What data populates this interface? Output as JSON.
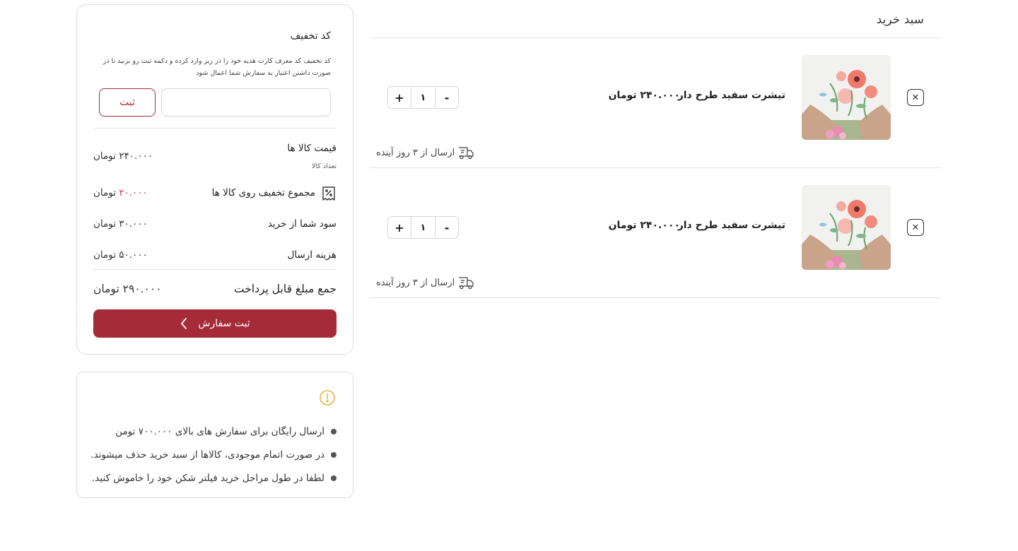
{
  "cart": {
    "title": "سبد خرید",
    "items": [
      {
        "name": "تیشرت سفید طرح دار",
        "price": "۲۴۰.۰۰۰ تومان",
        "quantity": "۱",
        "increase_label": "+",
        "decrease_label": "-",
        "remove_icon": "close-icon",
        "delivery": "ارسال از ۳ روز آینده",
        "delivery_icon": "delivery-truck-icon"
      },
      {
        "name": "تیشرت سفید طرح دار",
        "price": "۲۴۰.۰۰۰ تومان",
        "quantity": "۱",
        "increase_label": "+",
        "decrease_label": "-",
        "remove_icon": "close-icon",
        "delivery": "ارسال از ۳ روز آینده",
        "delivery_icon": "delivery-truck-icon"
      }
    ]
  },
  "summary": {
    "discount": {
      "title": "کد تخفیف",
      "description": "کد تخفیف کد معرف کارت هدیه خود را در زیر وارد کرده و دکمه ثبت رو بزنید تا در صورت داشتن اعتبار به سفارش شما اعمال شود",
      "input_value": "",
      "submit_label": "ثبت"
    },
    "items_price": {
      "label": "قیمت کالا ها",
      "sublabel": "تعداد کالا",
      "value": "۲۴۰.۰۰۰ تومان"
    },
    "items_discount": {
      "label": "مجموع تخفیف روی کالا ها",
      "value_amount": "۲۰.۰۰۰",
      "value_unit": "تومان",
      "icon": "discount-tag-icon"
    },
    "your_profit": {
      "label": "سود شما از خرید",
      "value": "۳۰.۰۰۰ تومان"
    },
    "shipping": {
      "label": "هزینه ارسال",
      "value": "۵۰.۰۰۰ تومان"
    },
    "total": {
      "label": "جمع مبلغ قابل پرداخت",
      "value": "۲۹۰.۰۰۰ تومان"
    },
    "checkout_label": "ثبت سفارش"
  },
  "notes": {
    "icon": "info-icon",
    "items": [
      "ارسال رایگان برای سفارش های بالای ۷۰۰.۰۰۰ تومن",
      "در صورت اتمام موجودی، کالاها از سبد خرید حذف میشوند.",
      "لطفا در طول مراحل خرید فیلتر شکن خود را خاموش کنید."
    ]
  },
  "colors": {
    "accent": "#a62b39",
    "discount_value": "#c0394b",
    "info_icon": "#e6b53c",
    "border": "#dcdcdc"
  }
}
